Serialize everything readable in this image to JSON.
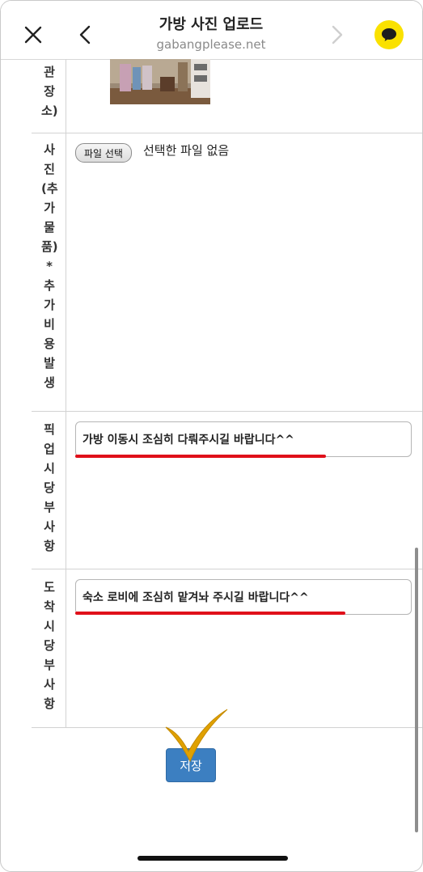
{
  "header": {
    "title": "가방 사진 업로드",
    "url": "gabangplease.net"
  },
  "rows": [
    {
      "label": "관장소)"
    },
    {
      "label": "사진(추가물품)*추가비용발생",
      "file_button": "파일 선택",
      "file_status": "선택한 파일 없음"
    },
    {
      "label": "픽업시당부사항",
      "value": "가방 이동시 조심히 다뤄주시길 바랍니다^^"
    },
    {
      "label": "도착시당부사항",
      "value": "숙소 로비에 조심히 맡겨놔 주시길 바랍니다^^"
    }
  ],
  "save_button": "저장",
  "colors": {
    "accent": "#3c7fc1",
    "kakao": "#fae100",
    "annotation_underline": "#e0101a",
    "annotation_check": "#e0a100"
  }
}
